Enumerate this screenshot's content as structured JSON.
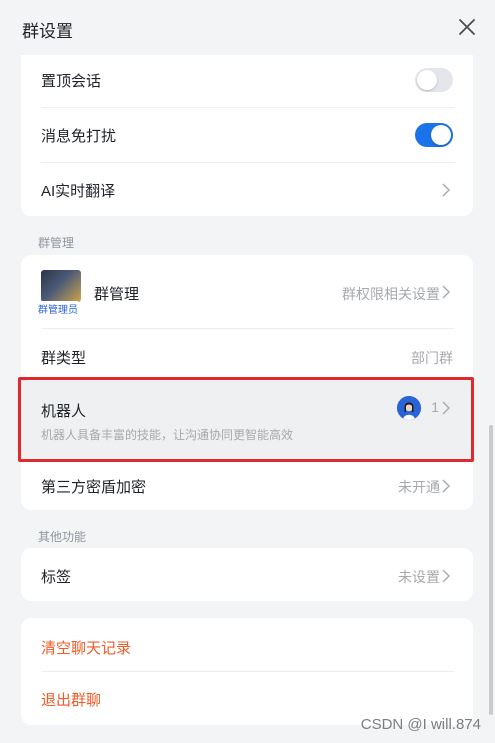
{
  "header": {
    "title": "群设置"
  },
  "settings": {
    "pin_chat": {
      "label": "置顶会话",
      "enabled": false
    },
    "mute": {
      "label": "消息免打扰",
      "enabled": true
    },
    "translate": {
      "label": "AI实时翻译"
    }
  },
  "group_management": {
    "section_title": "群管理",
    "manage": {
      "label": "群管理",
      "avatar_tag": "群管理员",
      "value": "群权限相关设置"
    },
    "group_type": {
      "label": "群类型",
      "value": "部门群"
    },
    "robot": {
      "label": "机器人",
      "description": "机器人具备丰富的技能，让沟通协同更智能高效",
      "count": "1"
    },
    "encryption": {
      "label": "第三方密盾加密",
      "value": "未开通"
    }
  },
  "other": {
    "section_title": "其他功能",
    "tags": {
      "label": "标签",
      "value": "未设置"
    }
  },
  "actions": {
    "clear_history": "清空聊天记录",
    "leave_group": "退出群聊"
  },
  "watermark": "CSDN @I will.874",
  "colors": {
    "accent": "#1a73e8",
    "danger": "#f25a27",
    "highlight": "#e0282e"
  }
}
